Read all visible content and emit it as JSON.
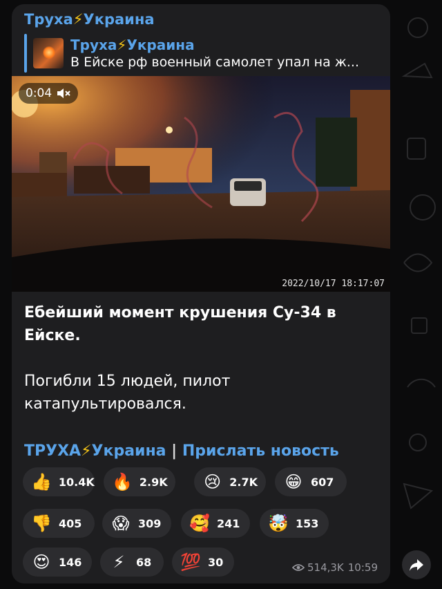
{
  "message": {
    "channel_name": "Труха⚡Украина",
    "reply": {
      "title": "Труха⚡Украина",
      "snippet": "В Ейске рф военный самолет упал на ж..."
    },
    "video": {
      "duration": "0:04",
      "timestamp_overlay": "2022/10/17  18:17:07"
    },
    "headline": "Ебейший момент крушения Су-34 в Ейске.",
    "body": "Погибли 15 людей, пилот катапультировался.",
    "footer_links": {
      "channel": "ТРУХА⚡Украина",
      "separator": "|",
      "submit": "Прислать новость"
    },
    "reactions": [
      {
        "emoji": "👍",
        "count": "10.4K"
      },
      {
        "emoji": "🔥",
        "count": "2.9K"
      },
      {
        "emoji": "😢",
        "count": "2.7K"
      },
      {
        "emoji": "😁",
        "count": "607"
      },
      {
        "emoji": "👎",
        "count": "405"
      },
      {
        "emoji": "😱",
        "count": "309"
      },
      {
        "emoji": "🥰",
        "count": "241"
      },
      {
        "emoji": "🤯",
        "count": "153"
      },
      {
        "emoji": "😍",
        "count": "146"
      },
      {
        "emoji": "⚡",
        "count": "68"
      },
      {
        "emoji": "💯",
        "count": "30"
      }
    ],
    "views": "514,3K",
    "time": "10:59"
  },
  "icons": {
    "mute": "speaker-muted-icon",
    "views": "eye-icon",
    "share": "share-arrow-icon"
  },
  "colors": {
    "accent": "#5aa4ea",
    "bubble": "#1e1e20",
    "reaction_pill": "#2c2c2f"
  }
}
